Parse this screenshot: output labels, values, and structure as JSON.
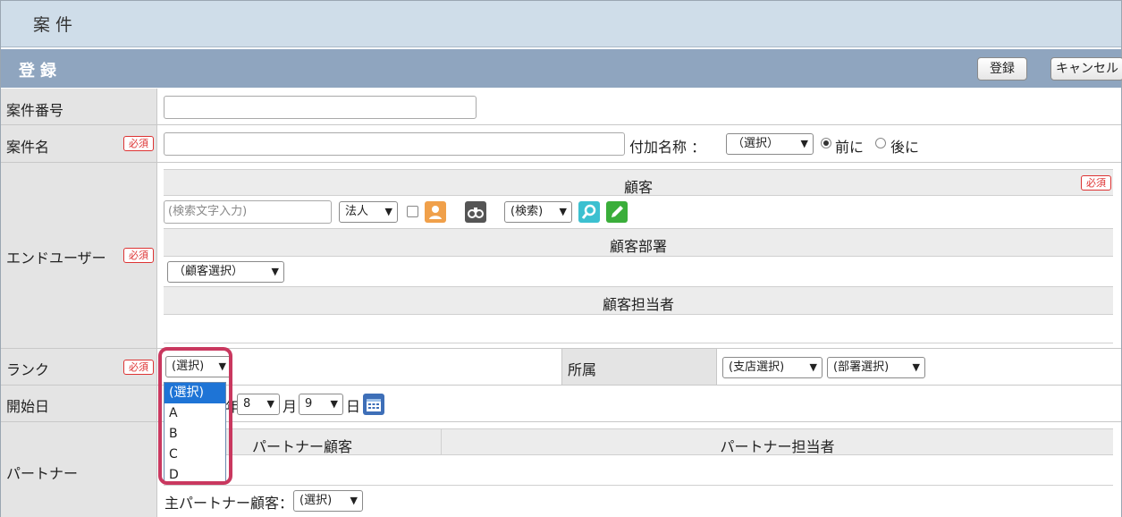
{
  "window_title": "案件",
  "section_title": "登録",
  "buttons": {
    "register": "登録",
    "cancel": "キャンセル"
  },
  "required_badge": "必須",
  "fields": {
    "case_number": {
      "label": "案件番号",
      "value": ""
    },
    "case_name": {
      "label": "案件名",
      "value": "",
      "suffix_label": "付加名称 ：",
      "suffix_select": "（選択）",
      "radio_before": "前に",
      "radio_after": "後に"
    },
    "end_user": {
      "label": "エンドユーザー",
      "customer_header": "顧客",
      "search_placeholder": "(検索文字入力)",
      "corp_select": "法人",
      "search_select": "(検索)",
      "dept_header": "顧客部署",
      "dept_select": "（顧客選択）",
      "contact_header": "顧客担当者"
    },
    "rank": {
      "label": "ランク",
      "selected": "(選択)",
      "options": [
        "(選択)",
        "A",
        "B",
        "C",
        "D"
      ],
      "affiliation_label": "所属",
      "branch_select": "(支店選択)",
      "dept_select": "(部署選択)"
    },
    "start_date": {
      "label": "開始日",
      "year_suffix": "年",
      "month_value": "8",
      "month_suffix": "月",
      "day_value": "9",
      "day_suffix": "日"
    },
    "partner": {
      "label": "パートナー",
      "col_customer": "パートナー顧客",
      "col_contact": "パートナー担当者",
      "main_label": "主パートナー顧客：",
      "main_select": "(選択)"
    }
  },
  "colors": {
    "title_bar": "#cfdde9",
    "section_bar": "#8fa5bf",
    "required": "#dd3333",
    "highlight": "#c9385f",
    "dropdown_selected": "#1e74d6"
  }
}
